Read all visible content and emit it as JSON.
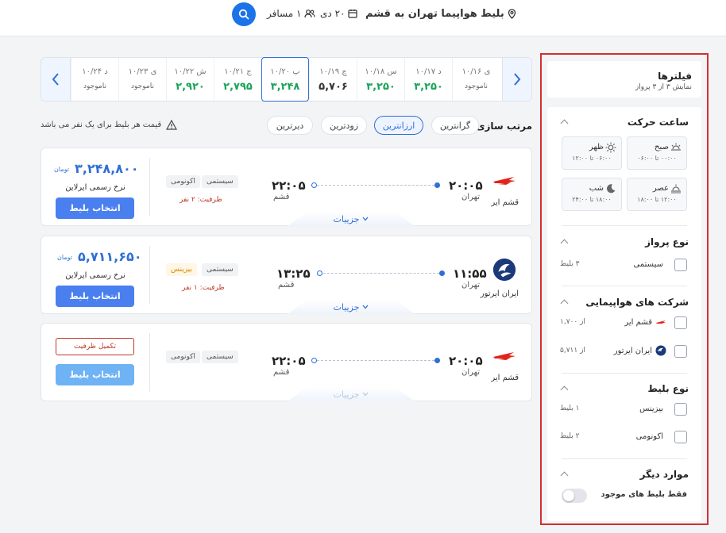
{
  "header": {
    "route": "بلیط هواپیما تهران به قشم",
    "date": "۲۰ دی",
    "passengers": "۱ مسافر"
  },
  "dates": [
    {
      "day": "د ۱۰/۲۴",
      "price": "ناموجود",
      "state": "na"
    },
    {
      "day": "ی ۱۰/۲۳",
      "price": "ناموجود",
      "state": "na"
    },
    {
      "day": "ش ۱۰/۲۲",
      "price": "۲,۹۲۰",
      "state": "green"
    },
    {
      "day": "ج ۱۰/۲۱",
      "price": "۲,۷۹۵",
      "state": "green"
    },
    {
      "day": "پ ۱۰/۲۰",
      "price": "۳,۲۴۸",
      "state": "green"
    },
    {
      "day": "چ ۱۰/۱۹",
      "price": "۵,۷۰۶",
      "state": "dark"
    },
    {
      "day": "س ۱۰/۱۸",
      "price": "۳,۲۵۰",
      "state": "green"
    },
    {
      "day": "د ۱۰/۱۷",
      "price": "۳,۲۵۰",
      "state": "green"
    },
    {
      "day": "ی ۱۰/۱۶",
      "price": "ناموجود",
      "state": "na"
    }
  ],
  "sort": {
    "label": "مرتب سازی:",
    "options": [
      "گرانترین",
      "ارزانترین",
      "زودترین",
      "دیرترین"
    ]
  },
  "price_note": "قیمت هر بلیط برای یک نفر می باشد",
  "flights": [
    {
      "airline": "قشم ایر",
      "dep_time": "۲۰:۰۵",
      "dep_city": "تهران",
      "arr_time": "۲۲:۰۵",
      "arr_city": "قشم",
      "tag_class": "سیستمی",
      "tag_cabin": "اکونومی",
      "capacity": "ظرفیت: ۲ نفر",
      "price": "۳,۲۴۸,۸۰۰",
      "currency": "تومان",
      "official": "نرخ رسمی ایرلاین",
      "select": "انتخاب بلیط",
      "details": "جزییات"
    },
    {
      "airline": "ایران ایرتور",
      "dep_time": "۱۱:۵۵",
      "dep_city": "تهران",
      "arr_time": "۱۳:۲۵",
      "arr_city": "قشم",
      "tag_class": "سیستمی",
      "tag_cabin": "بیزینس",
      "capacity": "ظرفیت: ۱ نفر",
      "price": "۵,۷۱۱,۶۵۰",
      "currency": "تومان",
      "official": "نرخ رسمی ایرلاین",
      "select": "انتخاب بلیط",
      "details": "جزییات"
    },
    {
      "airline": "قشم ایر",
      "dep_time": "۲۰:۰۵",
      "dep_city": "تهران",
      "arr_time": "۲۲:۰۵",
      "arr_city": "قشم",
      "tag_class": "سیستمی",
      "tag_cabin": "اکونومی",
      "full": "تکمیل ظرفیت",
      "select": "انتخاب بلیط",
      "details": "جزییات"
    }
  ],
  "filters": {
    "title": "فیلترها",
    "subtitle": "نمایش ۳ از ۳ پرواز",
    "departure": {
      "title": "ساعت حرکت",
      "slots": [
        {
          "name": "صبح",
          "range": "۰۰:۰۰ تا ۰۶:۰۰",
          "icon": "sunrise-icon"
        },
        {
          "name": "ظهر",
          "range": "۰۶:۰۰ تا ۱۲:۰۰",
          "icon": "sun-icon"
        },
        {
          "name": "عصر",
          "range": "۱۲:۰۰ تا ۱۸:۰۰",
          "icon": "sunset-icon"
        },
        {
          "name": "شب",
          "range": "۱۸:۰۰ تا ۲۴:۰۰",
          "icon": "moon-icon"
        }
      ]
    },
    "flight_type": {
      "title": "نوع پرواز",
      "options": [
        {
          "label": "سیستمی",
          "count": "۳ بلیط"
        }
      ]
    },
    "airlines": {
      "title": "شرکت های هواپیمایی",
      "options": [
        {
          "label": "قشم ایر",
          "count": "از ۱,۷۰۰"
        },
        {
          "label": "ایران ایرتور",
          "count": "از ۵,۷۱۱"
        }
      ]
    },
    "ticket_type": {
      "title": "نوع بلیط",
      "options": [
        {
          "label": "بیزینس",
          "count": "۱ بلیط"
        },
        {
          "label": "اکونومی",
          "count": "۲ بلیط"
        }
      ]
    },
    "other": {
      "title": "موارد دیگر",
      "toggle_label": "فقط بلیط های موجود"
    }
  },
  "colors": {
    "primary": "#2f6fd6",
    "price_green": "#19a35a",
    "danger": "#c0392b",
    "filter_border": "#d32f2f"
  }
}
